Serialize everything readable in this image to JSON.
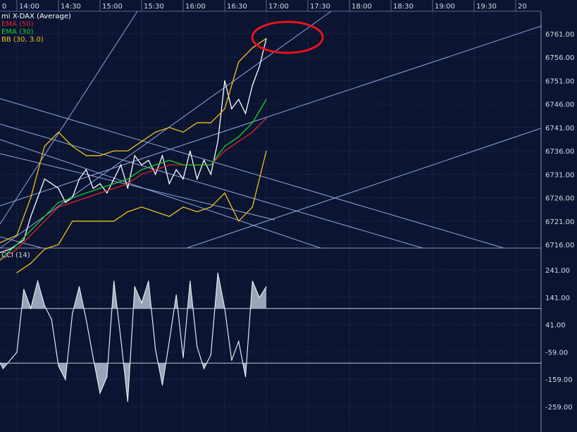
{
  "chart_data": [
    {
      "type": "line",
      "panel": "price",
      "legend": [
        {
          "label": "mi X-DAX (Average)",
          "color": "#ffffff"
        },
        {
          "label": "EMA (50)",
          "color": "#e0242a"
        },
        {
          "label": "EMA (30)",
          "color": "#1fcc2c"
        },
        {
          "label": "BB (30, 3.0)",
          "color": "#f0c21c"
        }
      ],
      "x_ticks": [
        "0",
        "14:00",
        "14:30",
        "15:00",
        "15:30",
        "16:00",
        "16:30",
        "17:00",
        "17:30",
        "18:00",
        "18:30",
        "19:00",
        "19:30",
        "20"
      ],
      "y_ticks": [
        "6761.00",
        "6756.00",
        "6751.00",
        "6746.00",
        "6741.00",
        "6736.00",
        "6731.00",
        "6726.00",
        "6721.00",
        "6716.00"
      ],
      "ylim": [
        6716,
        6761
      ],
      "grid": true,
      "series": [
        {
          "name": "mi X-DAX (Average)",
          "color": "#ffffff",
          "x": [
            "13:45",
            "13:55",
            "14:00",
            "14:05",
            "14:10",
            "14:15",
            "14:20",
            "14:25",
            "14:30",
            "14:35",
            "14:40",
            "14:45",
            "14:50",
            "14:55",
            "15:00",
            "15:05",
            "15:10",
            "15:15",
            "15:20",
            "15:25",
            "15:30",
            "15:35",
            "15:40",
            "15:45",
            "15:50",
            "15:55",
            "16:00",
            "16:05",
            "16:10",
            "16:15",
            "16:20",
            "16:25",
            "16:30",
            "16:35",
            "16:40",
            "16:45",
            "16:50",
            "16:55",
            "17:00"
          ],
          "values": [
            6714,
            6715,
            6716,
            6717,
            6722,
            6726,
            6730,
            6729,
            6728,
            6725,
            6726,
            6730,
            6732,
            6728,
            6729,
            6727,
            6730,
            6733,
            6728,
            6735,
            6733,
            6734,
            6731,
            6735,
            6729,
            6732,
            6730,
            6736,
            6730,
            6734,
            6731,
            6738,
            6751,
            6745,
            6747,
            6744,
            6750,
            6754,
            6760
          ]
        },
        {
          "name": "EMA (50)",
          "color": "#e0242a",
          "x": [
            "13:45",
            "14:00",
            "14:10",
            "14:20",
            "14:30",
            "14:40",
            "14:50",
            "15:00",
            "15:10",
            "15:20",
            "15:30",
            "15:40",
            "15:50",
            "16:00",
            "16:10",
            "16:20",
            "16:30",
            "16:40",
            "16:50",
            "17:00"
          ],
          "values": [
            6712,
            6715,
            6718,
            6721,
            6724,
            6725,
            6726,
            6727,
            6728,
            6729,
            6731,
            6732,
            6733,
            6733,
            6733,
            6733,
            6736,
            6738,
            6740,
            6743
          ]
        },
        {
          "name": "EMA (30)",
          "color": "#1fcc2c",
          "x": [
            "13:45",
            "14:00",
            "14:10",
            "14:20",
            "14:30",
            "14:40",
            "14:50",
            "15:00",
            "15:10",
            "15:20",
            "15:30",
            "15:40",
            "15:50",
            "16:00",
            "16:10",
            "16:20",
            "16:30",
            "16:40",
            "16:50",
            "17:00"
          ],
          "values": [
            6712,
            6716,
            6719,
            6722,
            6725,
            6726,
            6727,
            6728,
            6729,
            6730,
            6732,
            6733,
            6734,
            6733,
            6733,
            6733,
            6737,
            6739,
            6742,
            6747
          ]
        },
        {
          "name": "BB upper",
          "color": "#f0c21c",
          "x": [
            "13:45",
            "14:00",
            "14:10",
            "14:20",
            "14:30",
            "14:40",
            "14:50",
            "15:00",
            "15:10",
            "15:20",
            "15:30",
            "15:40",
            "15:50",
            "16:00",
            "16:10",
            "16:20",
            "16:30",
            "16:40",
            "16:50",
            "17:00"
          ],
          "values": [
            6716,
            6718,
            6726,
            6737,
            6740,
            6737,
            6735,
            6735,
            6736,
            6736,
            6738,
            6740,
            6741,
            6740,
            6742,
            6742,
            6745,
            6755,
            6758,
            6760
          ]
        },
        {
          "name": "BB lower",
          "color": "#f0c21c",
          "x": [
            "14:00",
            "14:10",
            "14:20",
            "14:30",
            "14:40",
            "14:50",
            "15:00",
            "15:10",
            "15:20",
            "15:30",
            "15:40",
            "15:50",
            "16:00",
            "16:10",
            "16:20",
            "16:30",
            "16:40",
            "16:50",
            "17:00"
          ],
          "values": [
            6710,
            6712,
            6715,
            6716,
            6721,
            6721,
            6721,
            6721,
            6723,
            6724,
            6723,
            6722,
            6724,
            6723,
            6724,
            6727,
            6721,
            6724,
            6736
          ]
        }
      ]
    },
    {
      "type": "line",
      "panel": "oscillator",
      "legend": [
        {
          "label": "CCI (14)",
          "color": "#c9cfdb"
        }
      ],
      "y_ticks": [
        "241.00",
        "141.00",
        "41.00",
        "-59.00",
        "-159.00",
        "-259.00"
      ],
      "ylim": [
        -259,
        241
      ],
      "reference_lines": [
        100,
        -100
      ],
      "series": [
        {
          "name": "CCI (14)",
          "color": "#e6e8ee",
          "x": [
            "13:45",
            "13:50",
            "13:55",
            "14:00",
            "14:05",
            "14:10",
            "14:15",
            "14:20",
            "14:25",
            "14:30",
            "14:35",
            "14:40",
            "14:45",
            "14:50",
            "14:55",
            "15:00",
            "15:05",
            "15:10",
            "15:15",
            "15:20",
            "15:25",
            "15:30",
            "15:35",
            "15:40",
            "15:45",
            "15:50",
            "15:55",
            "16:00",
            "16:05",
            "16:10",
            "16:15",
            "16:20",
            "16:25",
            "16:30",
            "16:35",
            "16:40",
            "16:45",
            "16:50",
            "16:55",
            "17:00"
          ],
          "values": [
            -70,
            -120,
            -90,
            -60,
            170,
            100,
            200,
            110,
            60,
            -110,
            -160,
            80,
            180,
            60,
            -80,
            -210,
            -150,
            200,
            -10,
            -240,
            180,
            120,
            200,
            -50,
            -180,
            -20,
            150,
            -80,
            200,
            -40,
            -120,
            -70,
            230,
            100,
            -90,
            -20,
            -150,
            200,
            140,
            180
          ]
        }
      ]
    }
  ]
}
